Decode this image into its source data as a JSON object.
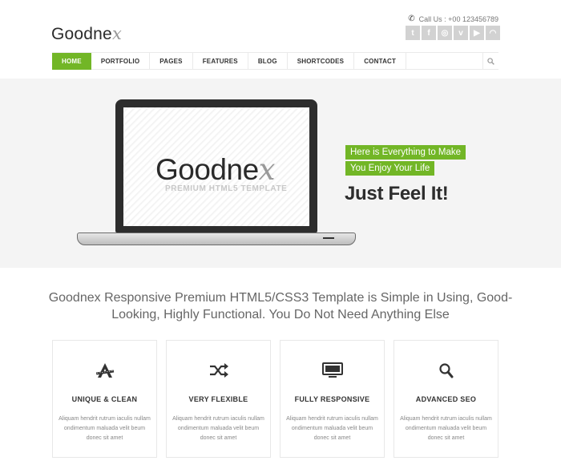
{
  "brand": {
    "name_main": "Goodne",
    "name_x": "x"
  },
  "contact": {
    "call": "Call Us : +00 123456789"
  },
  "socials": [
    {
      "icon": "twitter-icon",
      "glyph": "t"
    },
    {
      "icon": "facebook-icon",
      "glyph": "f"
    },
    {
      "icon": "dribbble-icon",
      "glyph": "◎"
    },
    {
      "icon": "vimeo-icon",
      "glyph": "v"
    },
    {
      "icon": "youtube-icon",
      "glyph": "▶"
    },
    {
      "icon": "rss-icon",
      "glyph": "◠"
    }
  ],
  "nav": {
    "items": [
      "HOME",
      "PORTFOLIO",
      "PAGES",
      "FEATURES",
      "BLOG",
      "SHORTCODES",
      "CONTACT"
    ],
    "active": "HOME"
  },
  "hero": {
    "screen_logo_main": "Goodne",
    "screen_logo_x": "x",
    "screen_subtitle": "PREMIUM HTML5 TEMPLATE",
    "tag1": "Here is Everything to Make",
    "tag2": "You Enjoy Your Life",
    "tagline": "Just Feel It!"
  },
  "intro": "Goodnex Responsive Premium HTML5/CSS3 Template is Simple in Using, Good-Looking, Highly Functional. You Do Not Need Anything Else",
  "features": [
    {
      "icon": "design-tools-icon",
      "title": "UNIQUE & CLEAN",
      "text": "Aliquam hendrit rutrum iaculis nullam ondimentum maluada velit beum donec sit amet"
    },
    {
      "icon": "shuffle-icon",
      "title": "VERY FLEXIBLE",
      "text": "Aliquam hendrit rutrum iaculis nullam ondimentum maluada velit beum donec sit amet"
    },
    {
      "icon": "monitor-icon",
      "title": "FULLY RESPONSIVE",
      "text": "Aliquam hendrit rutrum iaculis nullam ondimentum maluada velit beum donec sit amet"
    },
    {
      "icon": "search-icon",
      "title": "ADVANCED SEO",
      "text": "Aliquam hendrit rutrum iaculis nullam ondimentum maluada velit beum donec sit amet"
    }
  ],
  "colors": {
    "accent": "#72b626",
    "hero_bg": "#f4f4f4",
    "social_bg": "#d2d2d2"
  }
}
